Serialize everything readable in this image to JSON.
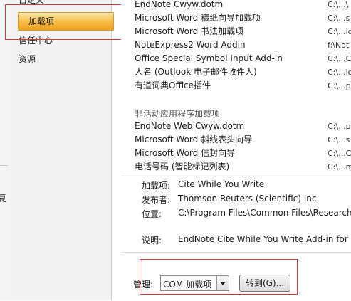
{
  "sidebar": {
    "items": [
      {
        "label": "自定义"
      },
      {
        "label": "加载项"
      },
      {
        "label": "信任中心"
      },
      {
        "label": "资源"
      }
    ]
  },
  "left_window": {
    "partial_char": "复"
  },
  "active_addins": [
    {
      "name": "EndNote Cwyw.dotm",
      "location": "C:\\...\\"
    },
    {
      "name": "Microsoft Word 稿纸向导加载项",
      "location": "C:\\...s"
    },
    {
      "name": "Microsoft Word 书法加载项",
      "location": "C:\\...ic"
    },
    {
      "name": "NoteExpress2 Word Addin",
      "location": "f:\\Not"
    },
    {
      "name": "Office Special Symbol Input Add-in",
      "location": "C:\\...C"
    },
    {
      "name": "人名 (Outlook 电子邮件收件人)",
      "location": "C:\\...ic"
    },
    {
      "name": "有道词典Office插件",
      "location": "C:\\...p"
    }
  ],
  "inactive_section": {
    "header": "非活动应用程序加载项",
    "items": [
      {
        "name": "EndNote Web Cwyw.dotm",
        "location": "C:\\...p"
      },
      {
        "name": "Microsoft Word 斜线表头向导",
        "location": "C:\\...s"
      },
      {
        "name": "Microsoft Word 信封向导",
        "location": "C:\\...C"
      },
      {
        "name": "电话号码 (智能标记列表)",
        "location": "C:\\...m"
      }
    ]
  },
  "details": {
    "addin_label": "加载项:",
    "addin_value": "Cite While You Write",
    "publisher_label": "发布者:",
    "publisher_value": "Thomson Reuters (Scientific) Inc.",
    "location_label": "位置:",
    "location_value": "C:\\Program Files\\Common Files\\ResearchS",
    "description_label": "说明:",
    "description_value": "EndNote Cite While You Write Add-in for"
  },
  "manage": {
    "label": "管理:",
    "selected": "COM 加载项",
    "go_button": "转到(G)..."
  }
}
